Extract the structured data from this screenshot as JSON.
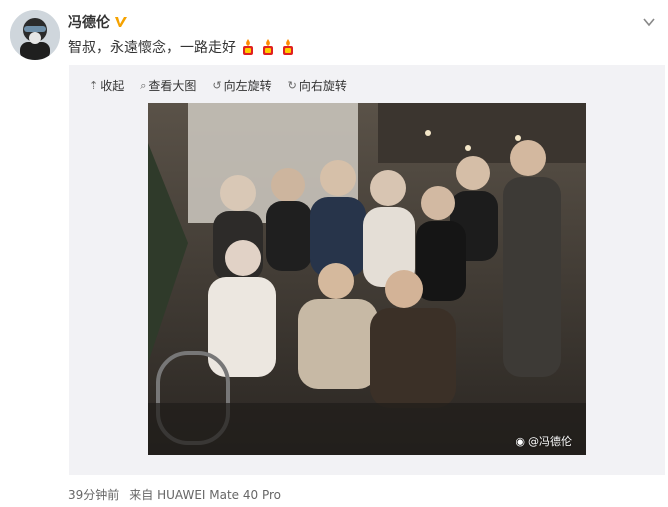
{
  "user": {
    "name": "冯德伦",
    "verified_icon": "verified-v-icon",
    "verified_color": "#f5a200"
  },
  "post": {
    "text": "智叔，永遠懷念，一路走好",
    "emoji": [
      "candle-icon",
      "candle-icon",
      "candle-icon"
    ],
    "time": "39分钟前",
    "source": "来自 HUAWEI Mate 40 Pro"
  },
  "toolbar": {
    "collapse_label": "收起",
    "view_large_label": "查看大图",
    "rotate_left_label": "向左旋转",
    "rotate_right_label": "向右旋转"
  },
  "photo": {
    "watermark": "@冯德伦"
  },
  "colors": {
    "media_bg": "#f2f2f5",
    "text": "#333333",
    "muted": "#666666"
  }
}
